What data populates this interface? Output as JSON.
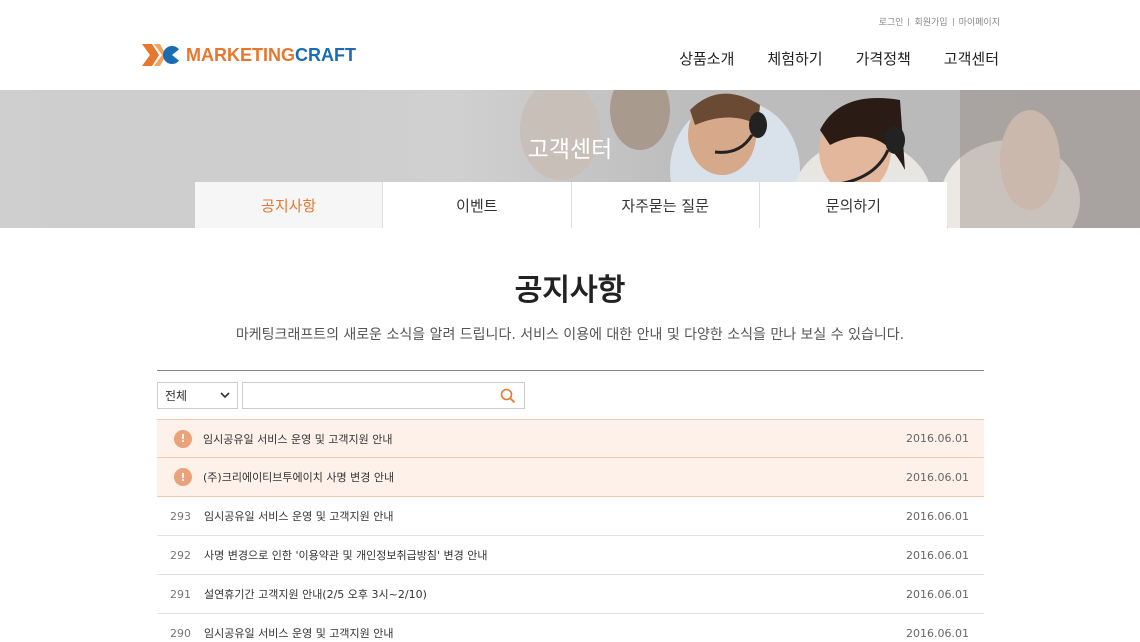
{
  "header": {
    "util_links": [
      "로그인",
      "회원가입",
      "마이페이지"
    ],
    "logo": {
      "part1": "MARKETING",
      "part2": "CRAFT"
    },
    "gnb": [
      "상품소개",
      "체험하기",
      "가격정책",
      "고객센터"
    ]
  },
  "hero": {
    "title": "고객센터",
    "tabs": [
      "공지사항",
      "이벤트",
      "자주묻는 질문",
      "문의하기"
    ],
    "active_tab": 0
  },
  "main": {
    "title": "공지사항",
    "description": "마케팅크래프트의 새로운 소식을 알려 드립니다. 서비스 이용에 대한 안내 및 다양한 소식을 만나 보실 수 있습니다.",
    "search": {
      "filter_value": "전체",
      "query": ""
    },
    "notices": [
      {
        "badge": "!",
        "subject": "임시공유일 서비스 운영 및 고객지원 안내",
        "date": "2016.06.01"
      },
      {
        "badge": "!",
        "subject": "(주)크리에이티브투에이치 사명 변경 안내",
        "date": "2016.06.01"
      }
    ],
    "posts": [
      {
        "num": "293",
        "subject": "임시공유일 서비스 운영 및 고객지원 안내",
        "date": "2016.06.01"
      },
      {
        "num": "292",
        "subject": "사명 변경으로 인한 '이용약관 및 개인정보취급방침' 변경 안내",
        "date": "2016.06.01"
      },
      {
        "num": "291",
        "subject": "설연휴기간 고객지원 안내(2/5 오후 3시~2/10)",
        "date": "2016.06.01"
      },
      {
        "num": "290",
        "subject": "임시공유일 서비스 운영 및 고객지원 안내",
        "date": "2016.06.01"
      }
    ]
  },
  "colors": {
    "accent": "#e8772e",
    "brand_blue": "#1b6cb3",
    "notice_bg": "#fdf1ea",
    "badge": "#eaa27a"
  },
  "icons": {
    "search": "search-icon",
    "select": "chevron-down-icon",
    "notice": "exclamation-badge-icon"
  }
}
